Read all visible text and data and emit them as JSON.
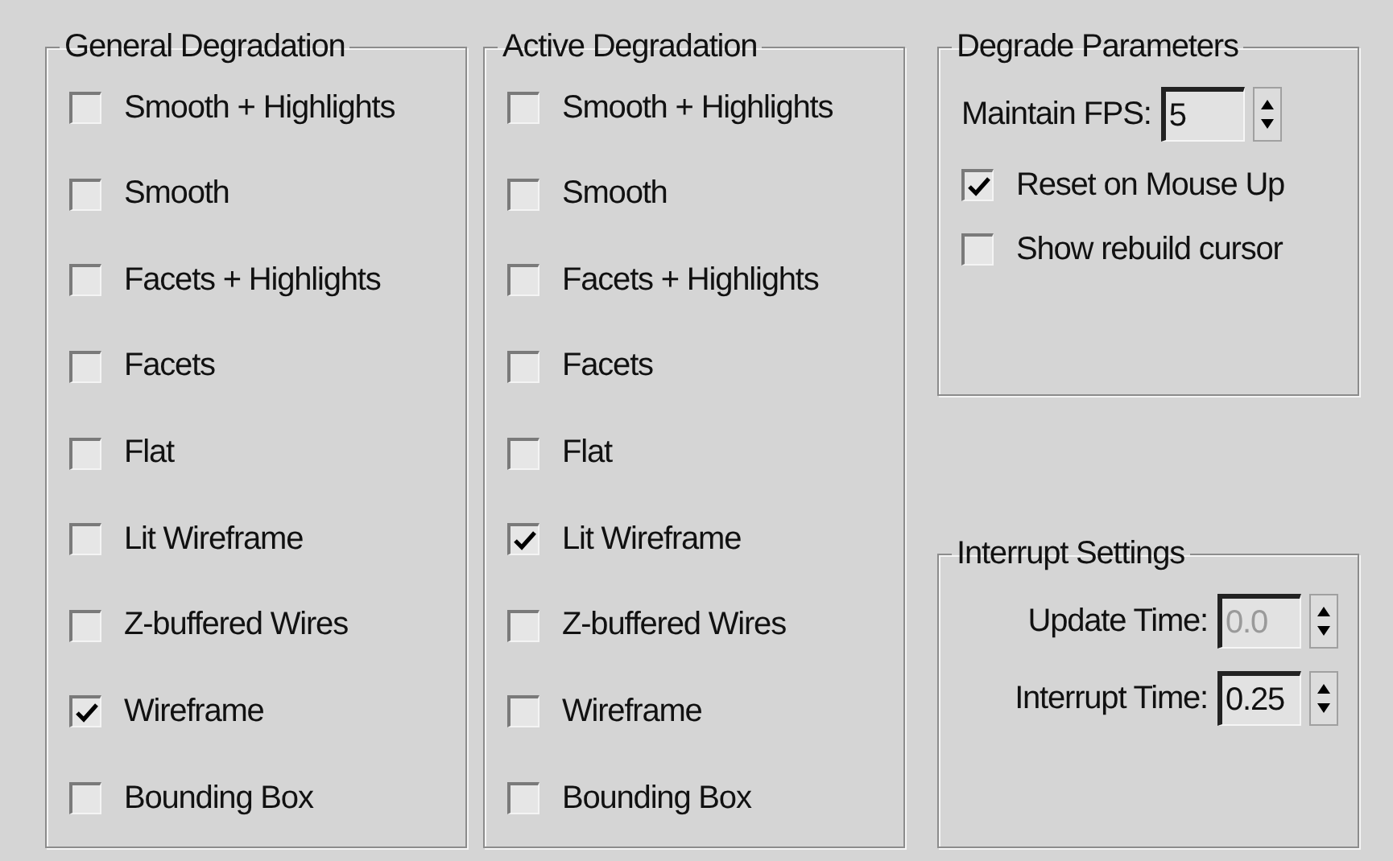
{
  "groups": [
    {
      "title": "General Degradation",
      "options": [
        {
          "label": "Smooth + Highlights",
          "checked": false
        },
        {
          "label": "Smooth",
          "checked": false
        },
        {
          "label": "Facets + Highlights",
          "checked": false
        },
        {
          "label": "Facets",
          "checked": false
        },
        {
          "label": "Flat",
          "checked": false
        },
        {
          "label": "Lit Wireframe",
          "checked": false
        },
        {
          "label": "Z-buffered Wires",
          "checked": false
        },
        {
          "label": "Wireframe",
          "checked": true
        },
        {
          "label": "Bounding Box",
          "checked": false
        }
      ]
    },
    {
      "title": "Active Degradation",
      "options": [
        {
          "label": "Smooth + Highlights",
          "checked": false
        },
        {
          "label": "Smooth",
          "checked": false
        },
        {
          "label": "Facets + Highlights",
          "checked": false
        },
        {
          "label": "Facets",
          "checked": false
        },
        {
          "label": "Flat",
          "checked": false
        },
        {
          "label": "Lit Wireframe",
          "checked": true
        },
        {
          "label": "Z-buffered Wires",
          "checked": false
        },
        {
          "label": "Wireframe",
          "checked": false
        },
        {
          "label": "Bounding Box",
          "checked": false
        }
      ]
    }
  ],
  "degrade_parameters": {
    "title": "Degrade Parameters",
    "fps": {
      "label": "Maintain FPS:",
      "value": "5",
      "disabled": false
    },
    "options": [
      {
        "label": "Reset on Mouse Up",
        "checked": true
      },
      {
        "label": "Show rebuild cursor",
        "checked": false
      }
    ]
  },
  "interrupt_settings": {
    "title": "Interrupt Settings",
    "fields": [
      {
        "label": "Update Time:",
        "value": "0.0",
        "disabled": true
      },
      {
        "label": "Interrupt Time:",
        "value": "0.25",
        "disabled": false
      }
    ]
  }
}
